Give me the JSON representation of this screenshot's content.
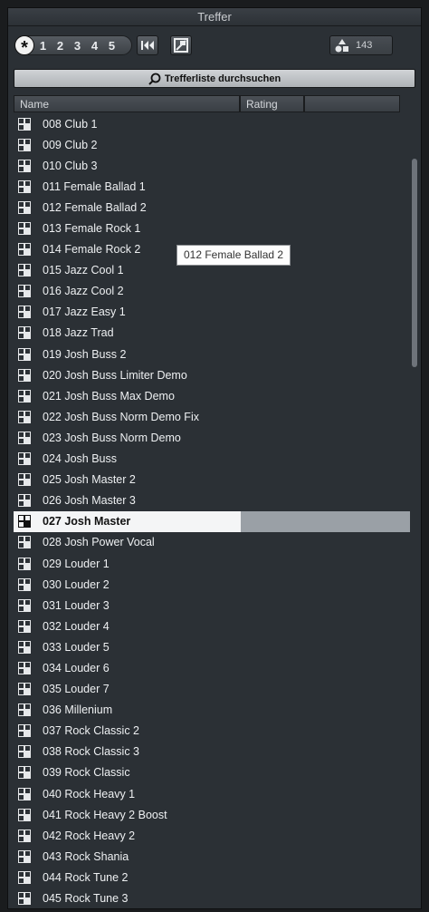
{
  "panel": {
    "title": "Treffer"
  },
  "toolbar": {
    "rating_filter": {
      "all": "*",
      "levels": [
        "1",
        "2",
        "3",
        "4",
        "5"
      ]
    },
    "first_button_icon": "skip-to-start-icon",
    "reset_button_icon": "reset-filter-icon",
    "result_count": "143",
    "count_icon": "shapes-icon"
  },
  "search": {
    "label": "Trefferliste durchsuchen",
    "icon": "search-icon"
  },
  "columns": {
    "name": "Name",
    "rating": "Rating"
  },
  "rows": [
    "008 Club 1",
    "009 Club 2",
    "010 Club 3",
    "011 Female Ballad 1",
    "012 Female Ballad 2",
    "013 Female Rock 1",
    "014 Female Rock 2",
    "015 Jazz Cool 1",
    "016 Jazz Cool 2",
    "017 Jazz Easy 1",
    "018 Jazz Trad",
    "019 Josh Buss 2",
    "020 Josh Buss Limiter Demo",
    "021 Josh Buss Max Demo",
    "022 Josh Buss Norm Demo Fix",
    "023 Josh Buss Norm Demo",
    "024 Josh Buss",
    "025 Josh Master 2",
    "026 Josh Master 3",
    "027 Josh Master",
    "028 Josh Power Vocal",
    "029 Louder 1",
    "030 Louder 2",
    "031 Louder 3",
    "032 Louder 4",
    "033 Louder 5",
    "034 Louder 6",
    "035 Louder 7",
    "036 Millenium",
    "037 Rock Classic 2",
    "038 Rock Classic 3",
    "039 Rock Classic",
    "040 Rock Heavy 1",
    "041 Rock Heavy 2 Boost",
    "042 Rock Heavy 2",
    "043 Rock Shania",
    "044 Rock Tune 2",
    "045 Rock Tune 3"
  ],
  "selected_index": 19,
  "row_icon": "preset-icon",
  "tooltip": {
    "text": "012 Female Ballad 2"
  }
}
